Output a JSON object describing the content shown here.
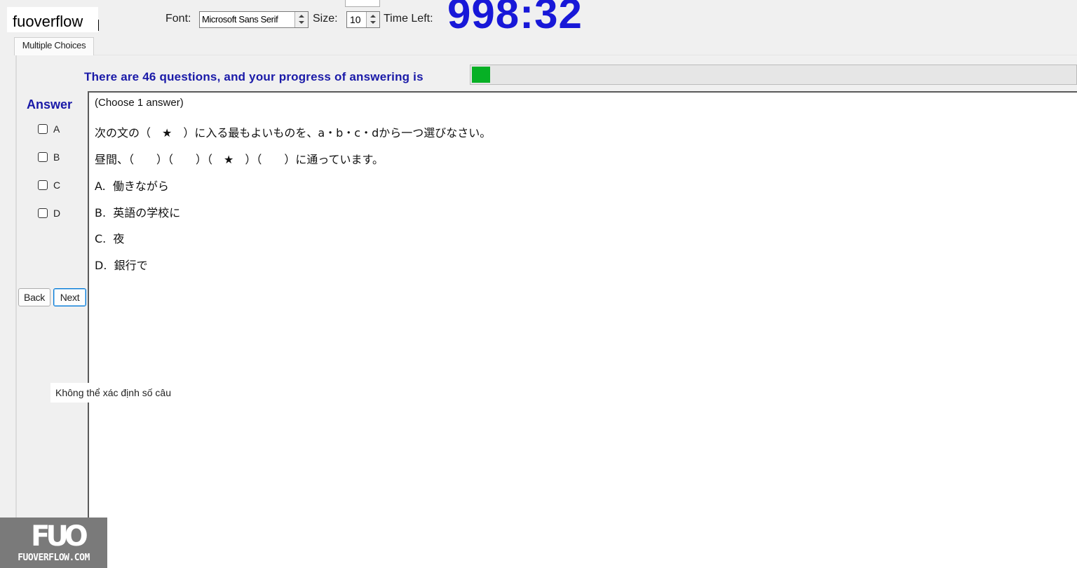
{
  "toolbar": {
    "font_label": "Font:",
    "font_value": "Microsoft Sans Serif",
    "size_label": "Size:",
    "size_value": "10",
    "time_left_label": "Time Left:",
    "time_left_value": "998:32"
  },
  "brand": {
    "text": "fuoverflow"
  },
  "tabs": [
    {
      "label": "Multiple Choices"
    }
  ],
  "progress": {
    "text": "There are 46 questions, and your progress of answering is",
    "fraction": 0.03,
    "color": "#06b025"
  },
  "answer": {
    "title": "Answer",
    "options": [
      "A",
      "B",
      "C",
      "D"
    ]
  },
  "nav": {
    "back_label": "Back",
    "next_label": "Next"
  },
  "question": {
    "instruction": "(Choose 1 answer)",
    "prompt": "次の文の（　★　）に入る最もよいものを、a・b・c・dから一つ選びなさい。",
    "sentence": "昼間、（　　）（　　）（　★　）（　　）に通っています。",
    "choices": [
      "A.  働きながら",
      "B.  英語の学校に",
      "C.  夜",
      "D.  銀行で"
    ]
  },
  "tooltip": {
    "text": "Không thể xác định số câu"
  },
  "watermark": {
    "mark": "FUO",
    "text": "FUOVERFLOW.COM"
  },
  "colors": {
    "timer": "#1818d8",
    "heading": "#1a1aa8",
    "background": "#f0f0f0"
  }
}
